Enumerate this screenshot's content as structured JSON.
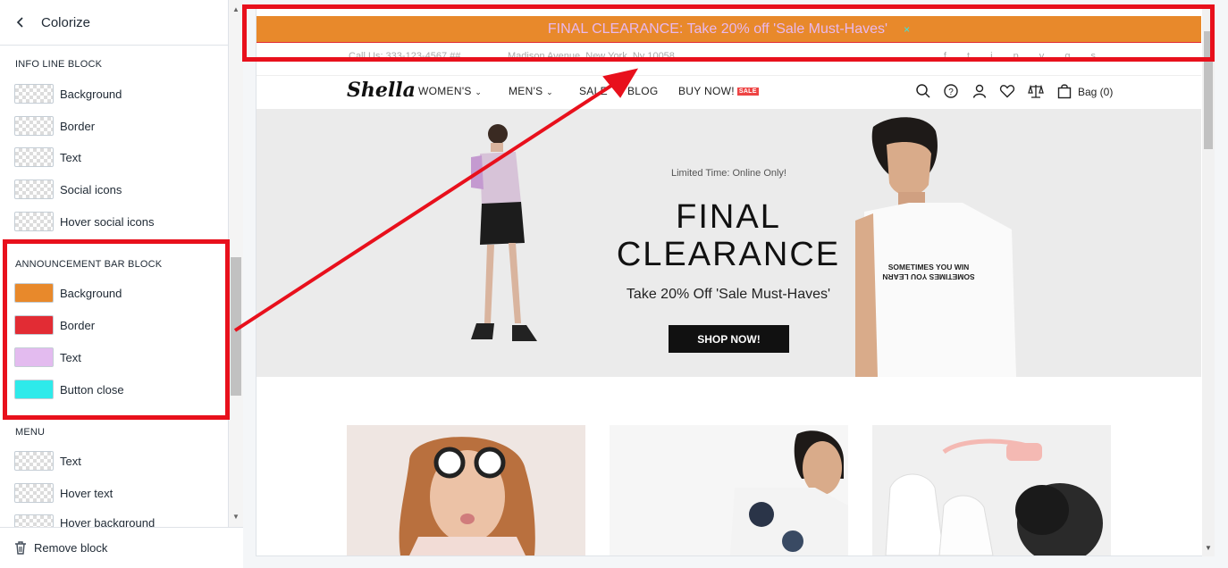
{
  "sidebar": {
    "header": {
      "title": "Colorize"
    },
    "sections": {
      "info_line": {
        "title": "INFO LINE BLOCK",
        "items": [
          {
            "label": "Background",
            "color": "transparent"
          },
          {
            "label": "Border",
            "color": "transparent"
          },
          {
            "label": "Text",
            "color": "transparent"
          },
          {
            "label": "Social icons",
            "color": "transparent"
          },
          {
            "label": "Hover social icons",
            "color": "transparent"
          }
        ]
      },
      "announcement": {
        "title": "ANNOUNCEMENT BAR BLOCK",
        "items": [
          {
            "label": "Background",
            "color": "#e8892b"
          },
          {
            "label": "Border",
            "color": "#e22c34"
          },
          {
            "label": "Text",
            "color": "#e3bbef"
          },
          {
            "label": "Button close",
            "color": "#2eeaea"
          }
        ]
      },
      "menu": {
        "title": "MENU",
        "items": [
          {
            "label": "Text",
            "color": "transparent"
          },
          {
            "label": "Hover text",
            "color": "transparent"
          },
          {
            "label": "Hover background",
            "color": "transparent"
          }
        ]
      }
    },
    "footer": {
      "remove_label": "Remove block"
    }
  },
  "preview": {
    "announcement_bar": {
      "text": "FINAL CLEARANCE: Take 20% off 'Sale Must-Haves'",
      "close": "×"
    },
    "info_line": {
      "phone": "Call Us: 333-123-4567 ##",
      "address": "Madison Avenue, New York, Ny 10058",
      "socials": "f t i p y g s"
    },
    "logo": "Shella",
    "nav": [
      {
        "label": "WOMEN'S",
        "has_dropdown": true
      },
      {
        "label": "MEN'S",
        "has_dropdown": true
      },
      {
        "label": "SALE"
      },
      {
        "label": "BLOG"
      },
      {
        "label": "BUY NOW!",
        "badge": "SALE"
      }
    ],
    "header_icons": [
      "search-icon",
      "help-icon",
      "account-icon",
      "wishlist-icon",
      "compare-icon",
      "bag-icon"
    ],
    "bag_label": "Bag (0)",
    "hero": {
      "pre_title": "Limited Time: Online Only!",
      "title_line1": "FINAL",
      "title_line2": "CLEARANCE",
      "subtitle": "Take 20% Off 'Sale Must-Haves'",
      "button": "SHOP NOW!",
      "shirt_text_1": "SOMETIMES YOU WIN",
      "shirt_text_2": "SOMETIMES YOU LEARN"
    }
  },
  "colors": {
    "highlight": "#e8101c",
    "accent_orange": "#e8892b"
  }
}
